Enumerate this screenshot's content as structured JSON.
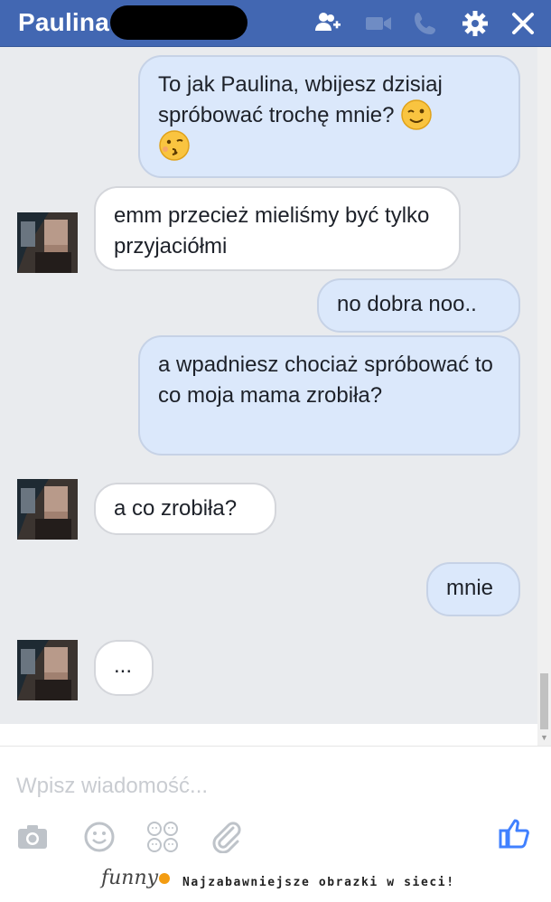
{
  "header": {
    "title": "Paulina",
    "icons": [
      "add-people-icon",
      "video-call-icon",
      "phone-icon",
      "gear-icon",
      "close-icon"
    ],
    "colors": {
      "bar": "#4267b2",
      "icon": "#ffffff",
      "icon_disabled": "#6f8cc4"
    }
  },
  "messages": [
    {
      "from": "me",
      "text": "To jak Paulina, wbijesz dzisiaj spróbować trochę mnie?",
      "emojis": [
        "wink-emoji",
        "kiss-emoji"
      ]
    },
    {
      "from": "them",
      "text": "emm przecież mieliśmy być tylko przyjaciółmi"
    },
    {
      "from": "me",
      "text": "no dobra noo.."
    },
    {
      "from": "me",
      "text": "a wpadniesz chociaż spróbować to co moja mama zrobiła?"
    },
    {
      "from": "them",
      "text": "a co zrobiła?"
    },
    {
      "from": "me",
      "text": "mnie"
    },
    {
      "from": "them",
      "text": "..."
    }
  ],
  "composer": {
    "placeholder": "Wpisz wiadomość...",
    "tools": [
      "camera-icon",
      "smiley-icon",
      "stickers-icon",
      "attachment-icon",
      "like-icon"
    ]
  },
  "footer": {
    "logo": "funny",
    "tagline": "Najzabawniejsze obrazki w sieci!"
  },
  "colors": {
    "chat_bg": "#e9ebee",
    "bubble_out": "#dbe8fb",
    "bubble_in": "#ffffff",
    "like_blue": "#4080ff"
  }
}
